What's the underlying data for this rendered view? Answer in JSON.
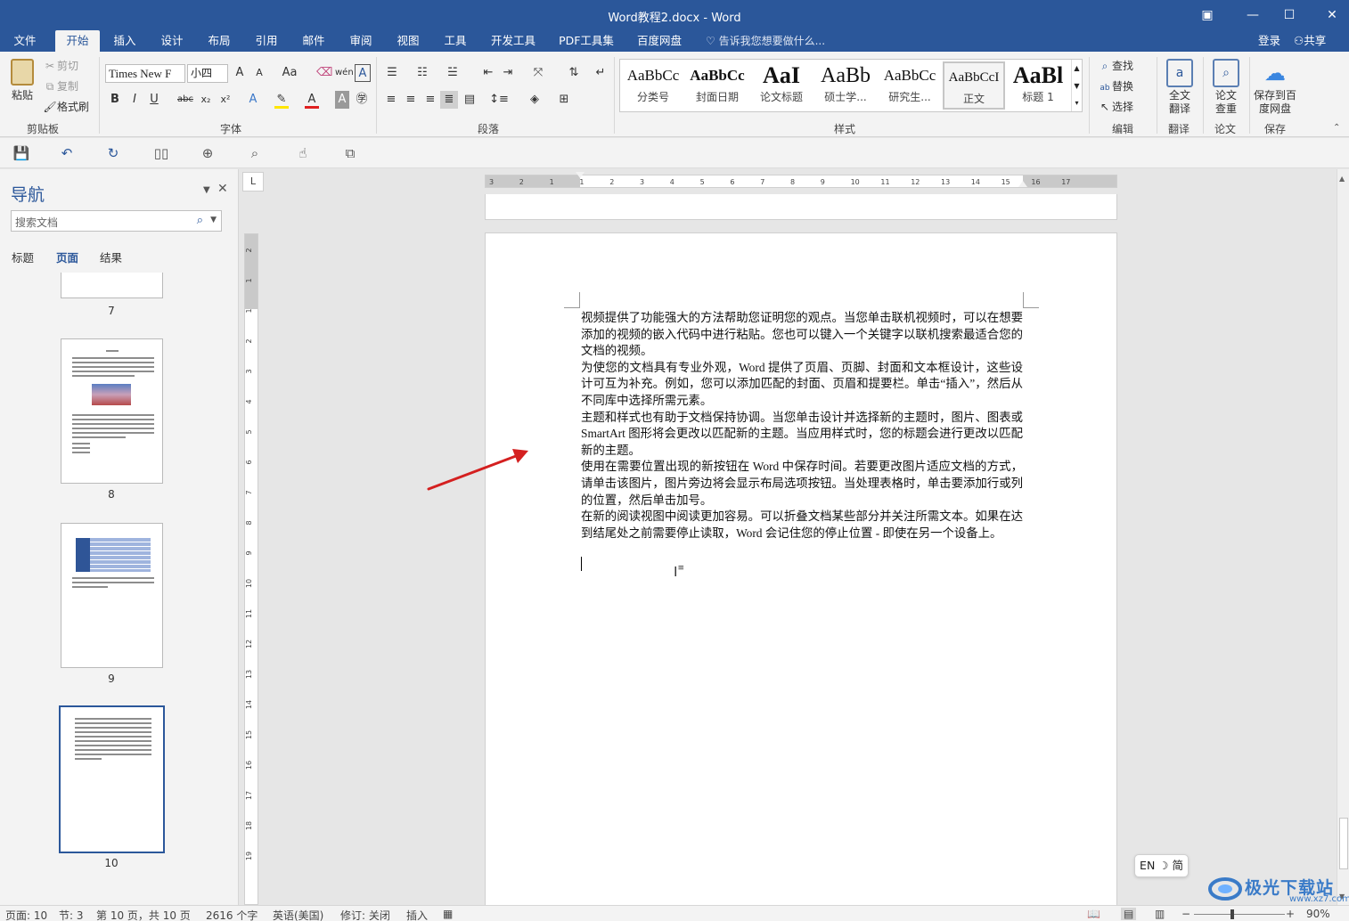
{
  "window": {
    "title": "Word教程2.docx - Word",
    "controls": [
      "restore-ribbon",
      "minimize",
      "maximize",
      "close"
    ]
  },
  "ribbon_tabs": [
    "文件",
    "开始",
    "插入",
    "设计",
    "布局",
    "引用",
    "邮件",
    "审阅",
    "视图",
    "工具",
    "开发工具",
    "PDF工具集",
    "百度网盘"
  ],
  "active_tab": "开始",
  "tell_me": "告诉我您想要做什么...",
  "account": {
    "login": "登录",
    "share": "共享"
  },
  "clipboard": {
    "paste": "粘贴",
    "cut": "剪切",
    "copy": "复制",
    "format_painter": "格式刷",
    "label": "剪贴板"
  },
  "font": {
    "name": "Times New F",
    "size": "小四",
    "label": "字体",
    "grow": "A",
    "shrink": "A",
    "case": "Aa",
    "bold": "B",
    "italic": "I",
    "underline": "U",
    "strike": "abc",
    "subscript": "x₂",
    "superscript": "x²",
    "char_border": "A",
    "phonetic": "wén"
  },
  "paragraph": {
    "label": "段落"
  },
  "styles": {
    "label": "样式",
    "items": [
      {
        "preview": "AaBbCc",
        "name": "分类号"
      },
      {
        "preview": "AaBbCc",
        "name": "封面日期"
      },
      {
        "preview": "AaI",
        "name": "论文标题"
      },
      {
        "preview": "AaBb",
        "name": "硕士学..."
      },
      {
        "preview": "AaBbCc",
        "name": "研究生..."
      },
      {
        "preview": "AaBbCcI",
        "name": "正文"
      },
      {
        "preview": "AaBl",
        "name": "标题 1"
      }
    ],
    "selected": "正文"
  },
  "editing": {
    "find": "查找",
    "replace": "替换",
    "select": "选择",
    "label": "编辑"
  },
  "translate": {
    "full": "全文翻译",
    "label": "翻译"
  },
  "paper": {
    "check": "论文查重",
    "label": "论文"
  },
  "save_group": {
    "save_to": "保存到百度网盘",
    "label": "保存"
  },
  "nav": {
    "title": "导航",
    "search_placeholder": "搜索文档",
    "tabs": [
      "标题",
      "页面",
      "结果"
    ],
    "active_tab": "页面",
    "pages": [
      "7",
      "8",
      "9",
      "10"
    ],
    "current_page": "10"
  },
  "document": {
    "paragraphs": [
      "视频提供了功能强大的方法帮助您证明您的观点。当您单击联机视频时，可以在想要添加的视频的嵌入代码中进行粘贴。您也可以键入一个关键字以联机搜索最适合您的文档的视频。",
      "为使您的文档具有专业外观，Word 提供了页眉、页脚、封面和文本框设计，这些设计可互为补充。例如，您可以添加匹配的封面、页眉和提要栏。单击“插入”，然后从不同库中选择所需元素。",
      "主题和样式也有助于文档保持协调。当您单击设计并选择新的主题时，图片、图表或 SmartArt 图形将会更改以匹配新的主题。当应用样式时，您的标题会进行更改以匹配新的主题。",
      "使用在需要位置出现的新按钮在 Word 中保存时间。若要更改图片适应文档的方式，请单击该图片，图片旁边将会显示布局选项按钮。当处理表格时，单击要添加行或列的位置，然后单击加号。",
      "在新的阅读视图中阅读更加容易。可以折叠文档某些部分并关注所需文本。如果在达到结尾处之前需要停止读取，Word 会记住您的停止位置 - 即使在另一个设备上。"
    ]
  },
  "ruler": {
    "h_ticks": [
      "3",
      "2",
      "1",
      "1",
      "2",
      "3",
      "4",
      "5",
      "6",
      "7",
      "8",
      "9",
      "10",
      "11",
      "12",
      "13",
      "14",
      "15",
      "16",
      "17"
    ],
    "v_ticks": [
      "2",
      "1",
      "1",
      "2",
      "3",
      "4",
      "5",
      "6",
      "7",
      "8",
      "9",
      "10",
      "11",
      "12",
      "13",
      "14",
      "15",
      "16",
      "17",
      "18",
      "19"
    ],
    "tab_selector": "L"
  },
  "ime": {
    "text": "EN ☽ 简"
  },
  "status": {
    "page": "页面: 10",
    "section": "节: 3",
    "page_of": "第 10 页，共 10 页",
    "words": "2616 个字",
    "language": "英语(美国)",
    "revisions": "修订: 关闭",
    "mode": "插入",
    "zoom": "90%"
  },
  "watermark": {
    "text": "极光下载站",
    "sub": "www.xz7.com"
  },
  "colors": {
    "brand": "#2b579a",
    "arrow": "#d42020"
  }
}
